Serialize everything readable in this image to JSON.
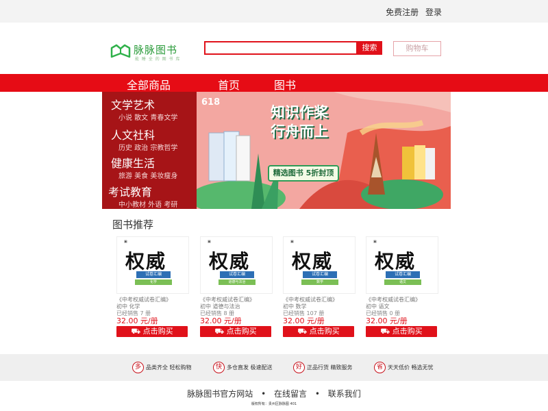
{
  "topbar": {
    "register": "免费注册",
    "login": "登录"
  },
  "logo": {
    "brand": "脉脉图书",
    "slogan": "能 睡 全 的 图 书 库"
  },
  "search": {
    "placeholder": "",
    "button": "搜索"
  },
  "cart": {
    "label": "购物车"
  },
  "nav": {
    "all": "全部商品",
    "home": "首页",
    "books": "图书"
  },
  "categories": [
    {
      "title": "文学艺术",
      "subs": "小说 散文 青春文学"
    },
    {
      "title": "人文社科",
      "subs": "历史 政治 宗教哲学"
    },
    {
      "title": "健康生活",
      "subs": "旅游 美食 美妆瘦身"
    },
    {
      "title": "考试教育",
      "subs": "中小教材 外语 考研"
    }
  ],
  "banner": {
    "badge": "618",
    "headline_1": "知识作桨",
    "headline_2": "行舟而上",
    "tagline": "精选图书 5折封顶"
  },
  "recommend": {
    "title": "图书推荐",
    "books": [
      {
        "cover_title": "权威",
        "cover_sub": "试卷汇编",
        "cover_subject": "化学",
        "name": "《中考权威试卷汇编》",
        "meta": "初中 化学",
        "sold": "已经销售 7 册",
        "price": "32.00 元/册",
        "buy": "点击购买"
      },
      {
        "cover_title": "权威",
        "cover_sub": "试卷汇编",
        "cover_subject": "道德与法治",
        "name": "《中考权威试卷汇编》",
        "meta": "初中 道德与法治",
        "sold": "已经销售 8 册",
        "price": "32.00 元/册",
        "buy": "点击购买"
      },
      {
        "cover_title": "权威",
        "cover_sub": "试卷汇编",
        "cover_subject": "数学",
        "name": "《中考权威试卷汇编》",
        "meta": "初中 数学",
        "sold": "已经销售 107 册",
        "price": "32.00 元/册",
        "buy": "点击购买"
      },
      {
        "cover_title": "权威",
        "cover_sub": "试卷汇编",
        "cover_subject": "语文",
        "name": "《中考权威试卷汇编》",
        "meta": "初中 语文",
        "sold": "已经销售 0 册",
        "price": "32.00 元/册",
        "buy": "点击购买"
      }
    ]
  },
  "features": [
    {
      "mark": "多",
      "label": "品类齐全  轻松购物"
    },
    {
      "mark": "快",
      "label": "多仓直发  极速配送"
    },
    {
      "mark": "好",
      "label": "正品行货  精致服务"
    },
    {
      "mark": "省",
      "label": "天天低价  畅选无忧"
    }
  ],
  "footer": {
    "site": "脉脉图书官方网站",
    "message": "在线留言",
    "contact": "联系我们",
    "sep": "•",
    "copyright": "版权所有：贵州区脉脉图 401"
  },
  "colors": {
    "accent": "#e0111a",
    "nav": "#e60c15",
    "category_bg": "#a61417",
    "brand_green": "#2a9b3a"
  }
}
